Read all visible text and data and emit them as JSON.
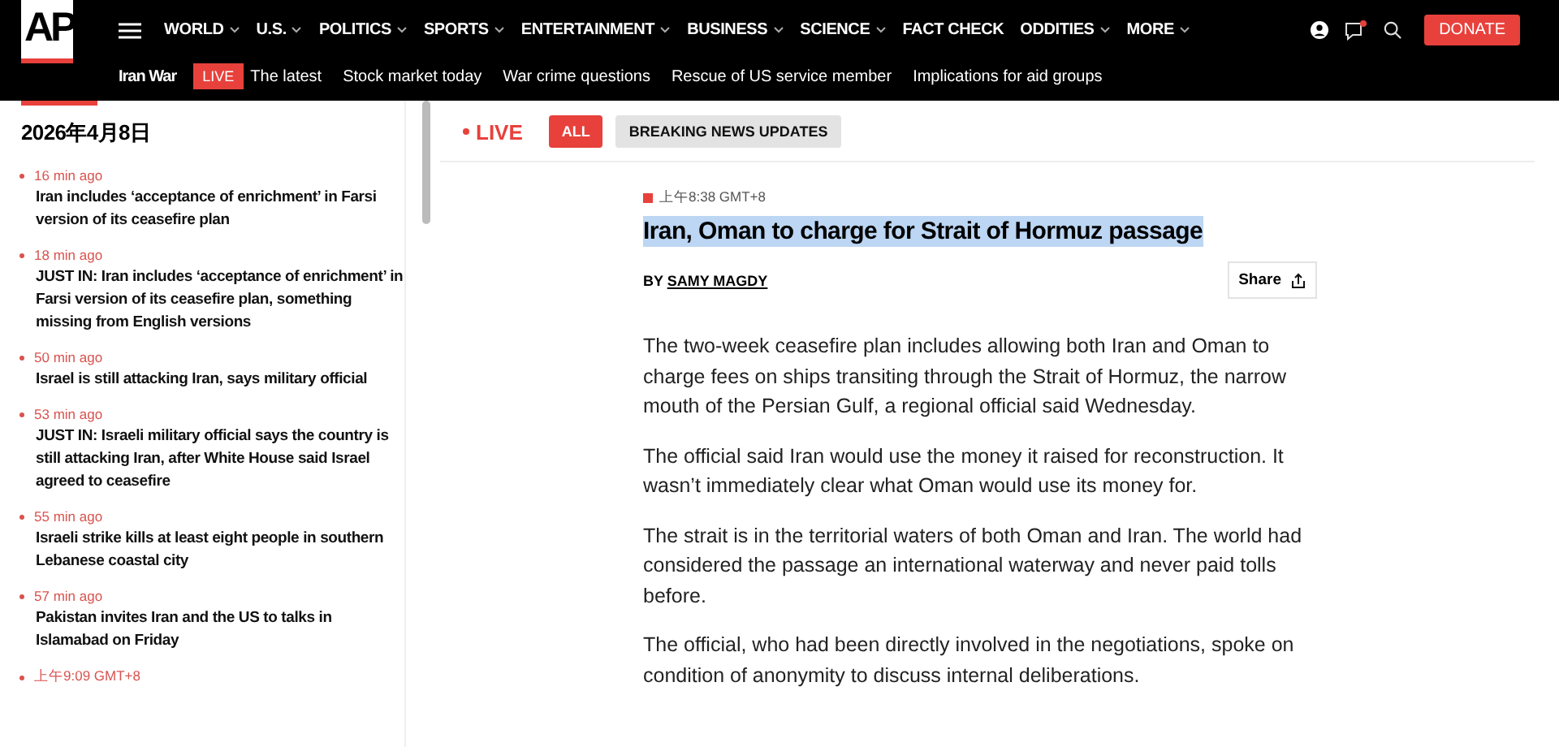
{
  "logo": {
    "text": "AP"
  },
  "nav": [
    {
      "label": "WORLD",
      "has_menu": true
    },
    {
      "label": "U.S.",
      "has_menu": true
    },
    {
      "label": "POLITICS",
      "has_menu": true
    },
    {
      "label": "SPORTS",
      "has_menu": true
    },
    {
      "label": "ENTERTAINMENT",
      "has_menu": true
    },
    {
      "label": "BUSINESS",
      "has_menu": true
    },
    {
      "label": "SCIENCE",
      "has_menu": true
    },
    {
      "label": "FACT CHECK",
      "has_menu": false
    },
    {
      "label": "ODDITIES",
      "has_menu": true
    },
    {
      "label": "MORE",
      "has_menu": true
    }
  ],
  "notifications": {
    "unread": true
  },
  "donate_button": "DONATE",
  "subnav": {
    "topic": "Iran War",
    "live_badge": "LIVE",
    "links": [
      "The latest",
      "Stock market today",
      "War crime questions",
      "Rescue of US service member",
      "Implications for aid groups"
    ]
  },
  "sidebar": {
    "date": "2026年4月8日",
    "items": [
      {
        "time": "16 min ago",
        "headline": "Iran includes ‘acceptance of enrichment’ in Farsi version of its ceasefire plan"
      },
      {
        "time": "18 min ago",
        "headline": "JUST IN: Iran includes ‘acceptance of enrichment’ in Farsi version of its ceasefire plan, something missing from English versions"
      },
      {
        "time": "50 min ago",
        "headline": "Israel is still attacking Iran, says military official"
      },
      {
        "time": "53 min ago",
        "headline": "JUST IN: Israeli military official says the country is still attacking Iran, after White House said Israel agreed to ceasefire"
      },
      {
        "time": "55 min ago",
        "headline": "Israeli strike kills at least eight people in southern Lebanese coastal city"
      },
      {
        "time": "57 min ago",
        "headline": "Pakistan invites Iran and the US to talks in Islamabad on Friday"
      },
      {
        "time": "上午9:09 GMT+8"
      }
    ]
  },
  "live_label": "LIVE",
  "filters": [
    {
      "label": "ALL",
      "selected": true
    },
    {
      "label": "BREAKING NEWS UPDATES",
      "selected": false
    }
  ],
  "article": {
    "time": "上午8:38 GMT+8",
    "headline": "Iran, Oman to charge for Strait of Hormuz passage",
    "highlighted": true,
    "byline_prefix": "BY",
    "author": "SAMY MAGDY",
    "share_button": "Share",
    "paragraphs": [
      "The two-week ceasefire plan includes allowing both Iran and Oman to charge fees on ships transiting through the Strait of Hormuz, the narrow mouth of the Persian Gulf, a regional official said Wednesday.",
      "The official said Iran would use the money it raised for reconstruction. It wasn’t immediately clear what Oman would use its money for.",
      "The strait is in the territorial waters of both Oman and Iran. The world had considered the passage an international waterway and never paid tolls before.",
      "The official, who had been directly involved in the negotiations, spoke on condition of anonymity to discuss internal deliberations."
    ]
  }
}
